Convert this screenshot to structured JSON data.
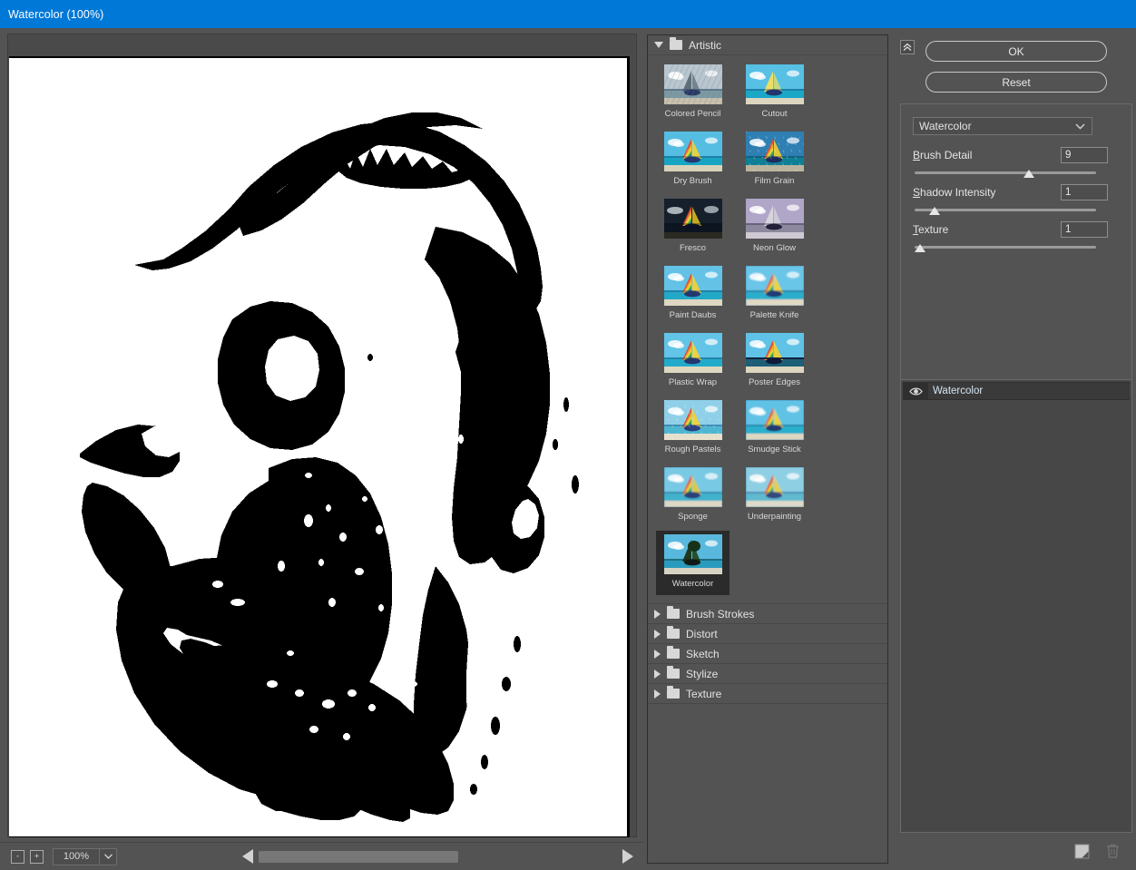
{
  "window": {
    "title": "Watercolor (100%)",
    "accent_color": "#0078d7"
  },
  "preview": {
    "artwork_description": "high-contrast black-and-white threshold portrait of a face",
    "background_color": "#ffffff",
    "ink_color": "#000000"
  },
  "statusbar": {
    "zoom_out_label": "-",
    "zoom_in_label": "+",
    "zoom_value": "100%",
    "zoom_dropdown_icon": "chevron-down-icon",
    "scroll_left_icon": "triangle-left-icon",
    "scroll_right_icon": "triangle-right-icon"
  },
  "gallery": {
    "expanded_category": {
      "label": "Artistic",
      "disclosure_icon": "triangle-down-icon",
      "folder_icon": "folder-icon"
    },
    "selected_filter": "Watercolor",
    "filters": [
      {
        "label": "Colored Pencil",
        "style": "pencil"
      },
      {
        "label": "Cutout",
        "style": "cutout"
      },
      {
        "label": "Dry Brush",
        "style": "drybrush"
      },
      {
        "label": "Film Grain",
        "style": "filmgrain"
      },
      {
        "label": "Fresco",
        "style": "fresco"
      },
      {
        "label": "Neon Glow",
        "style": "neonglow"
      },
      {
        "label": "Paint Daubs",
        "style": "paintdaubs"
      },
      {
        "label": "Palette Knife",
        "style": "paletteknife"
      },
      {
        "label": "Plastic Wrap",
        "style": "plasticwrap"
      },
      {
        "label": "Poster Edges",
        "style": "posteredges"
      },
      {
        "label": "Rough Pastels",
        "style": "roughpastels"
      },
      {
        "label": "Smudge Stick",
        "style": "smudgestick"
      },
      {
        "label": "Sponge",
        "style": "sponge"
      },
      {
        "label": "Underpainting",
        "style": "underpainting"
      },
      {
        "label": "Watercolor",
        "style": "watercolor"
      }
    ],
    "collapsed_categories": [
      {
        "label": "Brush Strokes"
      },
      {
        "label": "Distort"
      },
      {
        "label": "Sketch"
      },
      {
        "label": "Stylize"
      },
      {
        "label": "Texture"
      }
    ]
  },
  "settings": {
    "collapse_icon": "double-chevron-up-icon",
    "ok_label": "OK",
    "reset_label": "Reset",
    "filter_dropdown": {
      "selected": "Watercolor",
      "icon": "chevron-down-icon"
    },
    "sliders": [
      {
        "mnemonic": "B",
        "rest": "rush Detail",
        "value": "9",
        "percent": 62
      },
      {
        "mnemonic": "S",
        "rest": "hadow Intensity",
        "value": "1",
        "percent": 8
      },
      {
        "mnemonic": "T",
        "rest": "exture",
        "value": "1",
        "percent": 0
      }
    ]
  },
  "layers": {
    "items": [
      {
        "name": "Watercolor",
        "visible": true,
        "visibility_icon": "eye-icon"
      }
    ],
    "new_effect_layer_icon": "new-layer-icon",
    "delete_layer_icon": "trash-icon"
  }
}
